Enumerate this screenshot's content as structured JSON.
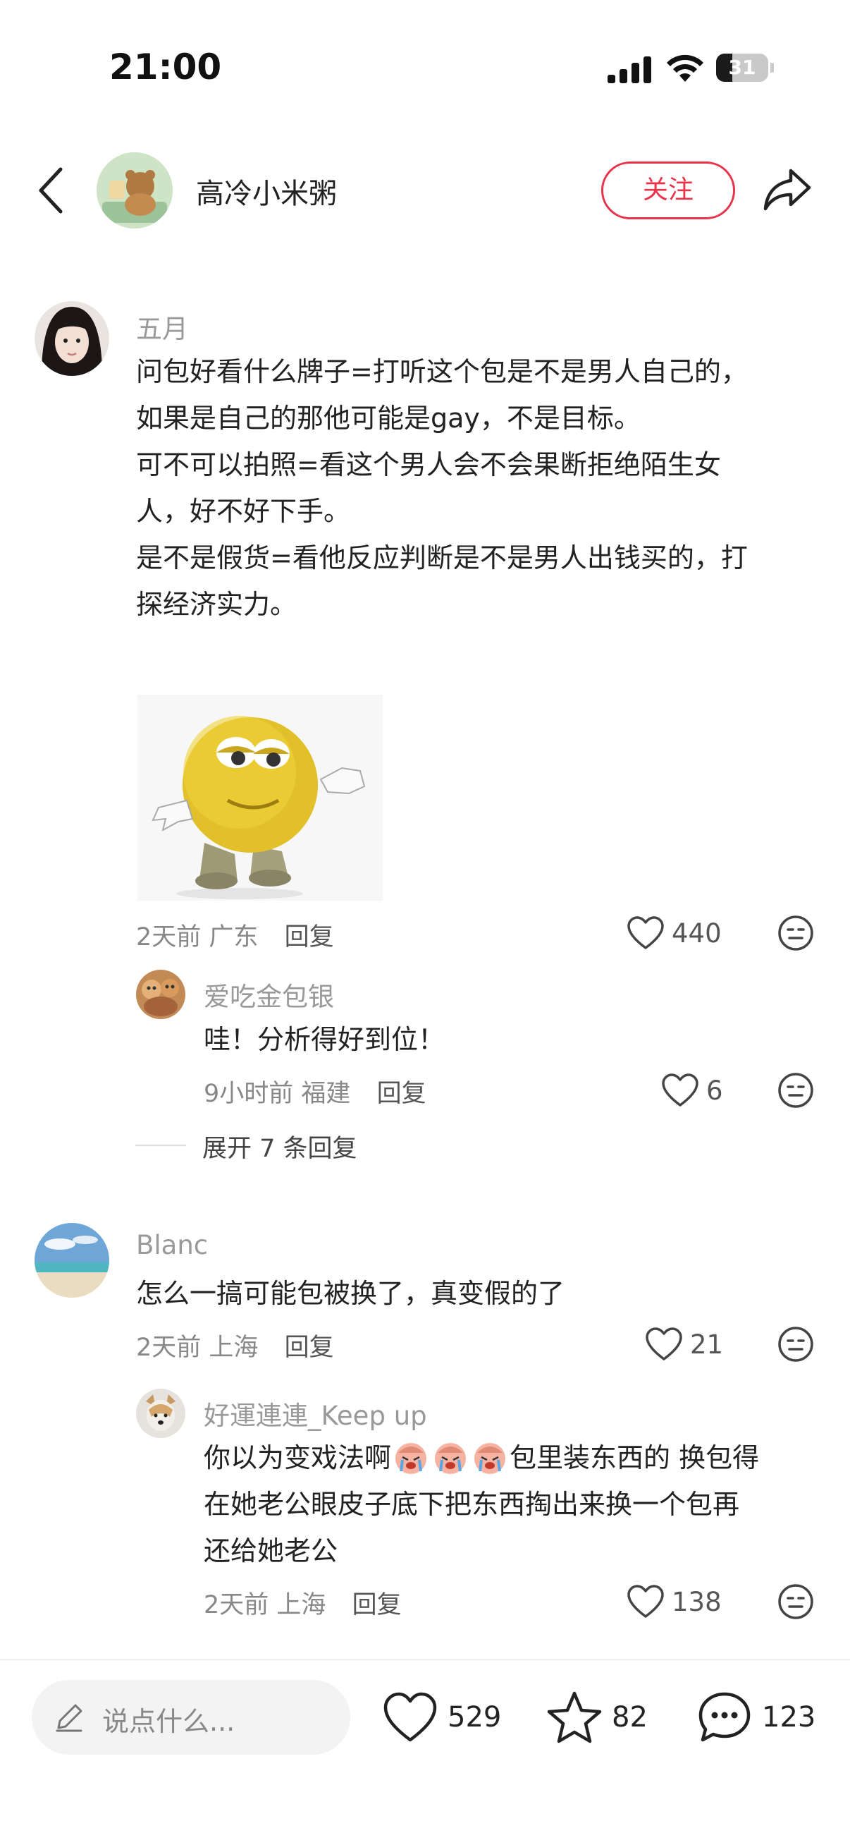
{
  "status_bar": {
    "time": "21:00",
    "battery": "31",
    "battery_level": 0.31
  },
  "header": {
    "author_name": "高冷小米粥",
    "follow_label": "关注"
  },
  "comments": [
    {
      "username": "五月",
      "lines": [
        "问包好看什么牌子=打听这个包是不是男人自己的，",
        "如果是自己的那他可能是gay，不是目标。",
        "可不可以拍照=看这个男人会不会果断拒绝陌生女",
        "人，好不好下手。",
        "是不是假货=看他反应判断是不是男人出钱买的，打",
        "探经济实力。"
      ],
      "time": "2天前",
      "location": "广东",
      "reply_label": "回复",
      "likes": "440",
      "sub": {
        "username": "爱吃金包银",
        "text": "哇！分析得好到位！",
        "time": "9小时前",
        "location": "福建",
        "reply_label": "回复",
        "likes": "6"
      },
      "expand_label": "展开 7 条回复"
    },
    {
      "username": "Blanc",
      "text": "怎么一搞可能包被换了，真变假的了",
      "time": "2天前",
      "location": "上海",
      "reply_label": "回复",
      "likes": "21",
      "sub": {
        "username": "好運連連_Keep up",
        "line1_prefix": "你以为变戏法啊",
        "line1_suffix": "包里装东西的 换包得",
        "line2": "在她老公眼皮子底下把东西掏出来换一个包再",
        "line3": "还给她老公",
        "time": "2天前",
        "location": "上海",
        "reply_label": "回复",
        "likes": "138"
      }
    }
  ],
  "bottom_bar": {
    "input_placeholder": "说点什么...",
    "likes": "529",
    "favorites": "82",
    "comments": "123"
  },
  "colors": {
    "accent": "#e8334a",
    "muted": "#999999"
  },
  "icons": [
    "back-icon",
    "share-icon",
    "heart-icon",
    "emoji-icon",
    "pencil-icon",
    "star-icon",
    "chat-icon",
    "signal-icon",
    "wifi-icon",
    "battery-icon"
  ]
}
